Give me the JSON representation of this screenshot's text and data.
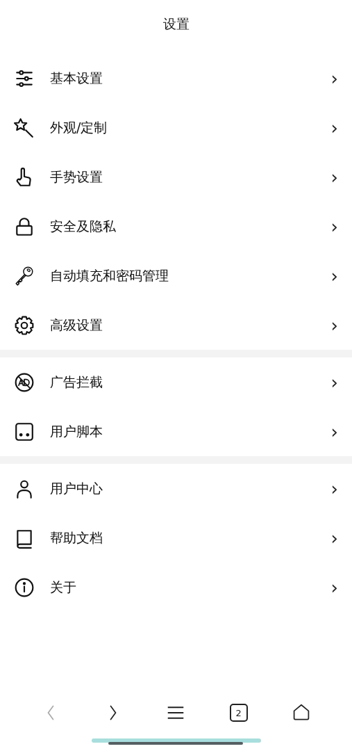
{
  "title": "设置",
  "groups": [
    {
      "items": [
        {
          "label": "基本设置",
          "arrow": "›"
        },
        {
          "label": "外观/定制",
          "arrow": "›"
        },
        {
          "label": "手势设置",
          "arrow": "›"
        },
        {
          "label": "安全及隐私",
          "arrow": "›"
        },
        {
          "label": "自动填充和密码管理",
          "arrow": "›"
        },
        {
          "label": "高级设置",
          "arrow": "›"
        }
      ]
    },
    {
      "items": [
        {
          "label": "广告拦截",
          "arrow": "›"
        },
        {
          "label": "用户脚本",
          "arrow": "›"
        }
      ]
    },
    {
      "items": [
        {
          "label": "用户中心",
          "arrow": "›"
        },
        {
          "label": "帮助文档",
          "arrow": "›"
        },
        {
          "label": "关于",
          "arrow": "›"
        }
      ]
    }
  ],
  "toolbar": {
    "back_disabled": true,
    "forward_disabled": false,
    "tab_count": "2"
  }
}
